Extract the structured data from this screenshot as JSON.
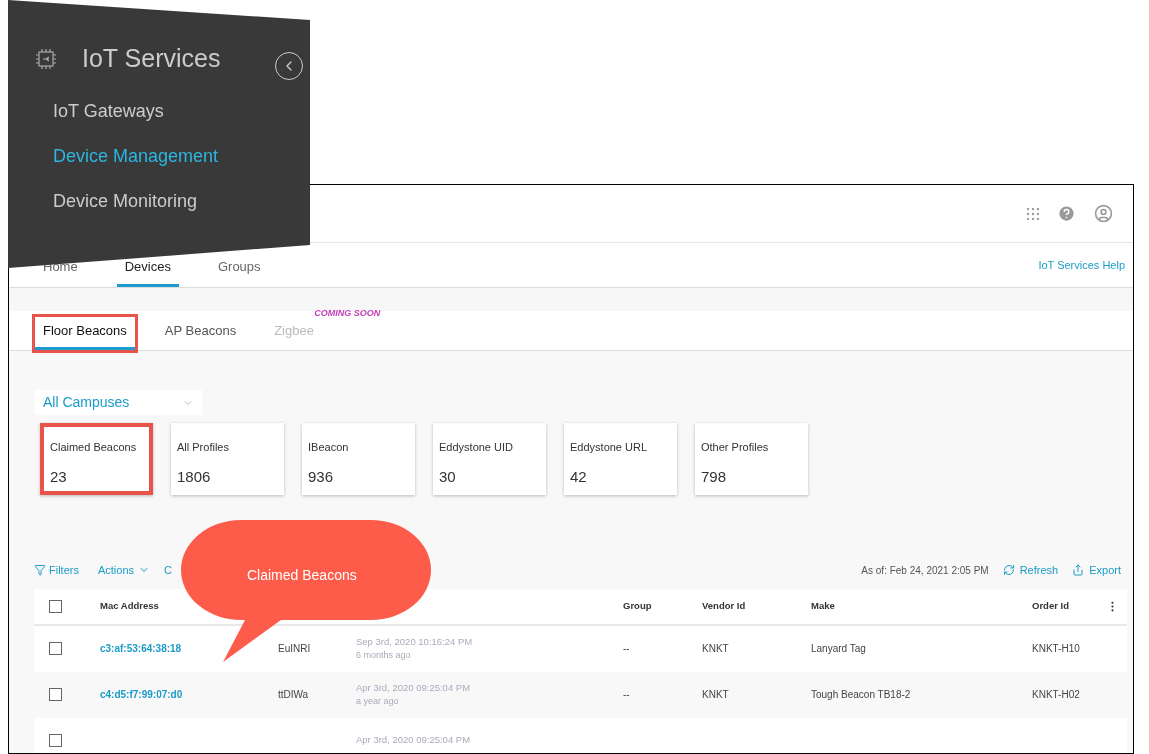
{
  "overlay_menu": {
    "title": "IoT Services",
    "items": [
      {
        "label": "IoT Gateways",
        "selected": false
      },
      {
        "label": "Device Management",
        "selected": true
      },
      {
        "label": "Device Monitoring",
        "selected": false
      }
    ]
  },
  "top_nav": {
    "tabs": [
      {
        "label": "Home",
        "selected": false
      },
      {
        "label": "Devices",
        "selected": true
      },
      {
        "label": "Groups",
        "selected": false
      }
    ],
    "help_link": "IoT Services Help"
  },
  "sub_tabs": [
    {
      "label": "Floor Beacons",
      "selected": true,
      "disabled": false,
      "highlighted": true
    },
    {
      "label": "AP Beacons",
      "selected": false,
      "disabled": false,
      "highlighted": false
    },
    {
      "label": "Zigbee",
      "selected": false,
      "disabled": true,
      "highlighted": false,
      "badge": "COMING SOON"
    }
  ],
  "campus_select": {
    "value": "All Campuses"
  },
  "summary_cards": [
    {
      "label": "Claimed Beacons",
      "value": "23",
      "highlighted": true
    },
    {
      "label": "All Profiles",
      "value": "1806",
      "highlighted": false
    },
    {
      "label": "IBeacon",
      "value": "936",
      "highlighted": false
    },
    {
      "label": "Eddystone UID",
      "value": "30",
      "highlighted": false
    },
    {
      "label": "Eddystone URL",
      "value": "42",
      "highlighted": false
    },
    {
      "label": "Other Profiles",
      "value": "798",
      "highlighted": false
    }
  ],
  "toolbar": {
    "filters": "Filters",
    "actions": "Actions",
    "column_3": "C",
    "as_of": "As of: Feb 24, 2021 2:05 PM",
    "refresh": "Refresh",
    "export": "Export"
  },
  "table": {
    "select_all_checked": false,
    "columns": [
      {
        "label": "Mac Address"
      },
      {},
      {},
      {
        "label": "Group"
      },
      {
        "label": "Vendor Id"
      },
      {
        "label": "Make"
      },
      {
        "label": "Order Id"
      }
    ],
    "rows": [
      {
        "checked": false,
        "cells": [
          {
            "text": "c3:af:53:64:38:18",
            "kind": "link"
          },
          {
            "text": "EuINRI"
          },
          {
            "text": "Sep 3rd, 2020 10:16:24 PM",
            "sub": "6 months ago",
            "kind": "date"
          },
          {
            "text": "--"
          },
          {
            "text": "KNKT"
          },
          {
            "text": "Lanyard Tag"
          },
          {
            "text": "KNKT-H10"
          }
        ]
      },
      {
        "checked": false,
        "cells": [
          {
            "text": "c4:d5:f7:99:07:d0",
            "kind": "link"
          },
          {
            "text": "ttDIWa"
          },
          {
            "text": "Apr 3rd, 2020 09:25:04 PM",
            "sub": "a year ago",
            "kind": "date"
          },
          {
            "text": "--"
          },
          {
            "text": "KNKT"
          },
          {
            "text": "Tough Beacon TB18-2"
          },
          {
            "text": "KNKT-H02"
          }
        ]
      },
      {
        "checked": false,
        "cells": [
          {},
          {},
          {
            "text": "Apr 3rd, 2020 09:25:04 PM",
            "kind": "date"
          },
          {},
          {},
          {},
          {}
        ]
      }
    ]
  },
  "callout": {
    "text": "Claimed Beacons"
  }
}
